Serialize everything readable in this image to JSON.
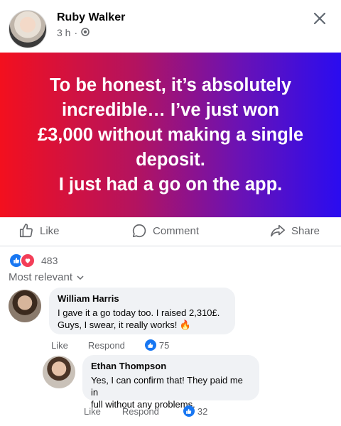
{
  "post": {
    "author": "Ruby Walker",
    "time": "3 h",
    "separator": "·",
    "banner_text": "To be honest, it’s absolutely\nincredible… I’ve just won\n£3,000 without making a single\ndeposit.\nI just had a go on the app."
  },
  "actions": {
    "like": "Like",
    "comment": "Comment",
    "share": "Share"
  },
  "reactions": {
    "count": "483"
  },
  "sort": {
    "label": "Most relevant"
  },
  "comments": [
    {
      "name": "William Harris",
      "text": "I gave it a go today too. I raised 2,310£.\nGuys, I swear, it really works! 🔥",
      "like": "Like",
      "respond": "Respond",
      "likes": "75"
    },
    {
      "name": "Ethan Thompson",
      "text": "Yes, I can confirm that! They paid me in\nfull without any problems.",
      "like": "Like",
      "respond": "Respond",
      "likes": "32"
    }
  ],
  "colors": {
    "accent": "#1877f2",
    "love": "#f33e58",
    "muted": "#65676b"
  }
}
